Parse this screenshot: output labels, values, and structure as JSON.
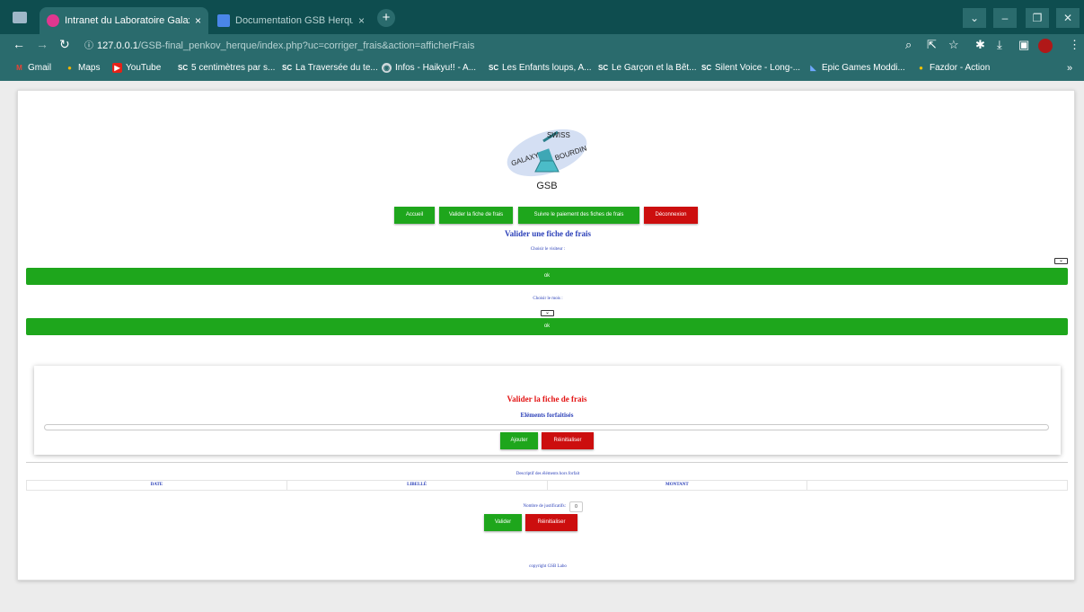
{
  "browser": {
    "tabs": [
      {
        "title": "Intranet du Laboratoire Galaxy-Sw"
      },
      {
        "title": "Documentation GSB Herque, Pen"
      }
    ],
    "new_tab": "+",
    "close_glyph": "×",
    "window_controls": [
      "⌄",
      "–",
      "❐",
      "✕"
    ],
    "url_host": "127.0.0.1",
    "url_path": "/GSB-final_penkov_herque/index.php?uc=corriger_frais&action=afficherFrais",
    "bookmarks": [
      "Gmail",
      "Maps",
      "YouTube",
      "5 centimètres par s...",
      "La Traversée du te...",
      "Infos - Haikyu!! - A...",
      "Les Enfants loups, A...",
      "Le Garçon et la Bêt...",
      "Silent Voice - Long-...",
      "Epic Games Moddi...",
      "Fazdor - Action"
    ],
    "bookmarks_more": "»"
  },
  "logo": {
    "top": "SWISS",
    "left": "GALAXY",
    "right": "BOURDIN",
    "caption": "GSB"
  },
  "nav": {
    "accueil": "Accueil",
    "valider": "Valider la fiche de frais",
    "suivre": "Suivre le paiement des fiches de frais",
    "deconnexion": "Déconnexion"
  },
  "form1": {
    "title": "Valider une fiche de frais",
    "visiteur_label": "Choisir le visiteur :",
    "ok1": "ok",
    "mois_label": "Choisir le mois :",
    "ok2": "ok"
  },
  "card": {
    "title": "Valider la fiche de frais",
    "subtitle": "Eléments forfaitisés",
    "ajouter": "Ajouter",
    "reinitialiser": "Réinitialiser"
  },
  "horsforfait": {
    "caption": "Descriptif des éléments hors forfait",
    "columns": [
      "DATE",
      "LIBELLÉ",
      "MONTANT",
      ""
    ],
    "justificatifs_label": "Nombre de justificatifs:",
    "justificatifs_value": "0",
    "valider": "Valider",
    "reinitialiser": "Réinitialiser"
  },
  "footer": "copyright GSB Labo",
  "colors": {
    "green": "#1ea61c",
    "red": "#cc0e0e",
    "title_blue": "#2a3fb8",
    "title_red": "#e31414",
    "chrome": "#2a6b6d"
  }
}
